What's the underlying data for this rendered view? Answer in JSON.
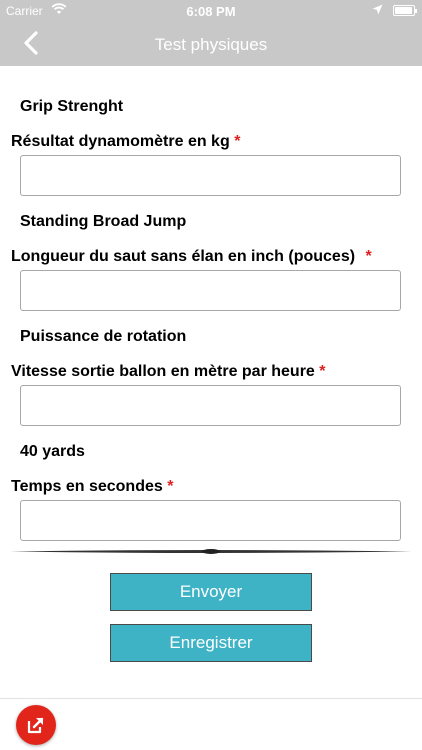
{
  "status_bar": {
    "carrier": "Carrier",
    "time": "6:08 PM"
  },
  "header": {
    "title": "Test physiques",
    "back_icon": "chevron-left-icon"
  },
  "colors": {
    "header_bg": "#c8c8c8",
    "accent": "#3eb3c6",
    "required": "#e02020",
    "fab": "#e1251b"
  },
  "form": {
    "sections": [
      {
        "title": "Grip Strenght",
        "label": "Résultat dynamomètre en kg",
        "required_mark": "*",
        "value": ""
      },
      {
        "title": "Standing Broad Jump",
        "label": "Longueur du saut sans élan en inch (pouces)",
        "required_mark": "*",
        "value": ""
      },
      {
        "title": "Puissance de rotation",
        "label": "Vitesse sortie ballon en mètre par heure",
        "required_mark": "*",
        "value": ""
      },
      {
        "title": "40 yards",
        "label": "Temps en secondes",
        "required_mark": "*",
        "value": ""
      }
    ]
  },
  "actions": {
    "send_label": "Envoyer",
    "save_label": "Enregistrer"
  },
  "footer": {
    "fab_icon": "share-export-icon"
  }
}
